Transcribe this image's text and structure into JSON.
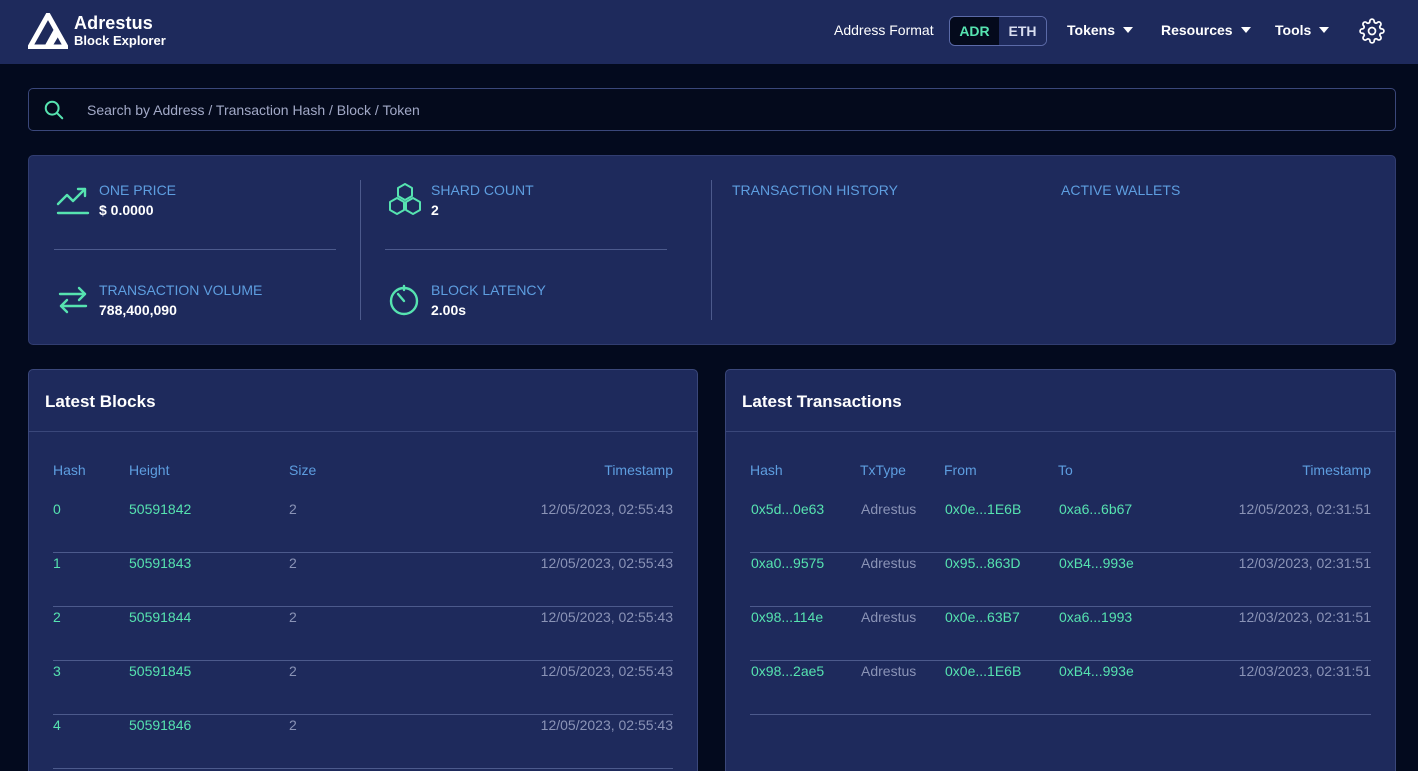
{
  "header": {
    "logo_title": "Adrestus",
    "logo_subtitle": "Block Explorer",
    "address_format_label": "Address Format",
    "format_options": [
      "ADR",
      "ETH"
    ],
    "selected_format": "ADR",
    "nav": [
      {
        "label": "Tokens"
      },
      {
        "label": "Resources"
      },
      {
        "label": "Tools"
      }
    ]
  },
  "search": {
    "placeholder": "Search by Address / Transaction Hash / Block / Token"
  },
  "stats": {
    "one_price": {
      "label": "ONE PRICE",
      "value": "$ 0.0000"
    },
    "shard_count": {
      "label": "SHARD COUNT",
      "value": "2"
    },
    "tx_volume": {
      "label": "TRANSACTION VOLUME",
      "value": "788,400,090"
    },
    "block_latency": {
      "label": "BLOCK LATENCY",
      "value": "2.00s"
    },
    "tx_history_title": "TRANSACTION HISTORY",
    "active_wallets_title": "ACTIVE WALLETS"
  },
  "latest_blocks": {
    "title": "Latest Blocks",
    "columns": [
      "Hash",
      "Height",
      "Size",
      "Timestamp"
    ],
    "rows": [
      {
        "hash": "0",
        "height": "50591842",
        "size": "2",
        "timestamp": "12/05/2023, 02:55:43"
      },
      {
        "hash": "1",
        "height": "50591843",
        "size": "2",
        "timestamp": "12/05/2023, 02:55:43"
      },
      {
        "hash": "2",
        "height": "50591844",
        "size": "2",
        "timestamp": "12/05/2023, 02:55:43"
      },
      {
        "hash": "3",
        "height": "50591845",
        "size": "2",
        "timestamp": "12/05/2023, 02:55:43"
      },
      {
        "hash": "4",
        "height": "50591846",
        "size": "2",
        "timestamp": "12/05/2023, 02:55:43"
      }
    ]
  },
  "latest_transactions": {
    "title": "Latest Transactions",
    "columns": [
      "Hash",
      "TxType",
      "From",
      "To",
      "Timestamp"
    ],
    "rows": [
      {
        "hash": "0x5d...0e63",
        "type": "Adrestus",
        "from": "0x0e...1E6B",
        "to": "0xa6...6b67",
        "timestamp": "12/05/2023, 02:31:51"
      },
      {
        "hash": "0xa0...9575",
        "type": "Adrestus",
        "from": "0x95...863D",
        "to": "0xB4...993e",
        "timestamp": "12/03/2023, 02:31:51"
      },
      {
        "hash": "0x98...114e",
        "type": "Adrestus",
        "from": "0x0e...63B7",
        "to": "0xa6...1993",
        "timestamp": "12/03/2023, 02:31:51"
      },
      {
        "hash": "0x98...2ae5",
        "type": "Adrestus",
        "from": "0x0e...1E6B",
        "to": "0xB4...993e",
        "timestamp": "12/03/2023, 02:31:51"
      }
    ]
  },
  "colors": {
    "accent": "#56e3b0",
    "label_blue": "#5e9ee0",
    "panel": "#1e2a5c",
    "background": "#030a1e"
  }
}
